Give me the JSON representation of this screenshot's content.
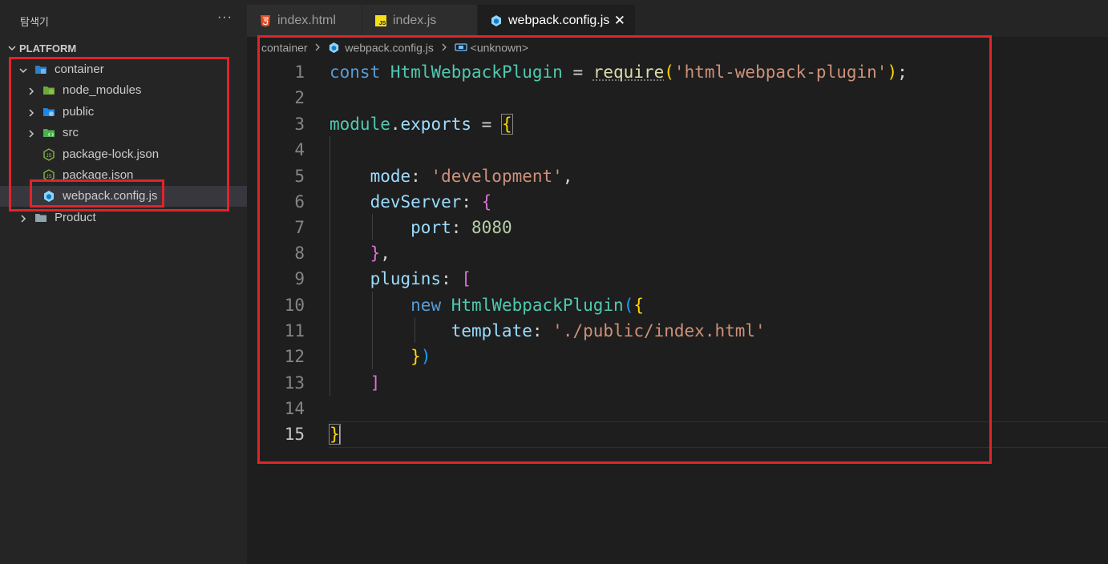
{
  "sidebar": {
    "title": "탐색기",
    "more": "···",
    "section": "PLATFORM",
    "items": [
      {
        "label": "container"
      },
      {
        "label": "node_modules"
      },
      {
        "label": "public"
      },
      {
        "label": "src"
      },
      {
        "label": "package-lock.json"
      },
      {
        "label": "package.json"
      },
      {
        "label": "webpack.config.js"
      },
      {
        "label": "Product"
      }
    ]
  },
  "tabs": [
    {
      "label": "index.html"
    },
    {
      "label": "index.js"
    },
    {
      "label": "webpack.config.js",
      "close": "✕"
    }
  ],
  "breadcrumb": {
    "folder": "container",
    "file": "webpack.config.js",
    "symbol": "<unknown>"
  },
  "editor": {
    "line_numbers": [
      "1",
      "2",
      "3",
      "4",
      "5",
      "6",
      "7",
      "8",
      "9",
      "10",
      "11",
      "12",
      "13",
      "14",
      "15"
    ],
    "current_line": "15",
    "tokens": {
      "const": "const",
      "class_name": "HtmlWebpackPlugin",
      "eq": " = ",
      "require": "require",
      "paren_open": "(",
      "req_string": "'html-webpack-plugin'",
      "paren_close": ")",
      "semi": ";",
      "module": "module",
      "dot": ".",
      "exports": "exports",
      "brace_open": "{",
      "brace_close": "}",
      "mode_key": "mode",
      "colon": ": ",
      "mode_val": "'development'",
      "comma": ",",
      "devserver_key": "devServer",
      "port_key": "port",
      "port_val": "8080",
      "plugins_key": "plugins",
      "bracket_open": "[",
      "bracket_close": "]",
      "new_kw": "new",
      "template_key": "template",
      "template_val": "'./public/index.html'"
    }
  },
  "colors": {
    "annotation": "#e0242b",
    "keyword": "#569cd6",
    "class": "#4ec9b0",
    "string": "#ce9178"
  }
}
